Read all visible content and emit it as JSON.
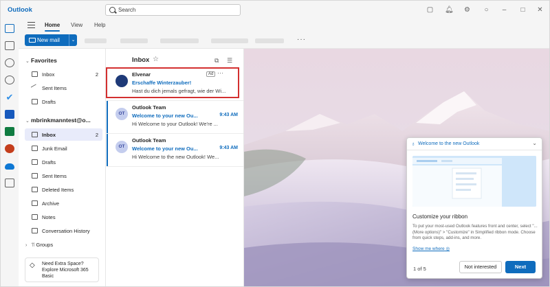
{
  "app": {
    "title": "Outlook"
  },
  "search": {
    "placeholder": "Search"
  },
  "ribbon": {
    "tabs": [
      {
        "label": "Home"
      },
      {
        "label": "View"
      },
      {
        "label": "Help"
      }
    ],
    "new_mail": "New mail",
    "more": "···"
  },
  "folders": {
    "favorites": {
      "label": "Favorites",
      "items": [
        {
          "label": "Inbox",
          "count": "2"
        },
        {
          "label": "Sent Items",
          "count": ""
        },
        {
          "label": "Drafts",
          "count": ""
        }
      ]
    },
    "account": {
      "label": "mbrinkmanntest@o...",
      "items": [
        {
          "label": "Inbox",
          "count": "2"
        },
        {
          "label": "Junk Email",
          "count": ""
        },
        {
          "label": "Drafts",
          "count": ""
        },
        {
          "label": "Sent Items",
          "count": ""
        },
        {
          "label": "Deleted Items",
          "count": ""
        },
        {
          "label": "Archive",
          "count": ""
        },
        {
          "label": "Notes",
          "count": ""
        },
        {
          "label": "Conversation History",
          "count": ""
        }
      ]
    },
    "groups": {
      "label": "Groups"
    },
    "upsell": {
      "line1": "Need Extra Space?",
      "line2": "Explore Microsoft 365",
      "line3": "Basic"
    }
  },
  "message_list": {
    "title": "Inbox",
    "messages": [
      {
        "avatar": "",
        "from": "Elvenar",
        "subject": "Erschaffe Winterzauber!",
        "preview": "Hast du dich jemals gefragt, wie der Wi...",
        "time": "",
        "badge": "Ad",
        "more": "···"
      },
      {
        "avatar": "OT",
        "from": "Outlook Team",
        "subject": "Welcome to your new Ou...",
        "preview": "Hi Welcome to your Outlook! We're ...",
        "time": "9:43 AM"
      },
      {
        "avatar": "OT",
        "from": "Outlook Team",
        "subject": "Welcome to your new Ou...",
        "preview": "Hi Welcome to the new Outlook! We...",
        "time": "9:43 AM"
      }
    ]
  },
  "callout": {
    "header": "Welcome to the new Outlook",
    "title": "Customize your ribbon",
    "body": "To put your most-used Outlook features front and center, select \"... (More options)\" > \"Customize\" in Simplified ribbon mode. Choose from quick steps, add-ins, and more.",
    "link": "Show me where",
    "page": "1 of 5",
    "not_interested": "Not interested",
    "next": "Next"
  },
  "colors": {
    "accent": "#0f6cbd",
    "highlight": "#d32f2f",
    "selected": "#e8ebfa"
  }
}
